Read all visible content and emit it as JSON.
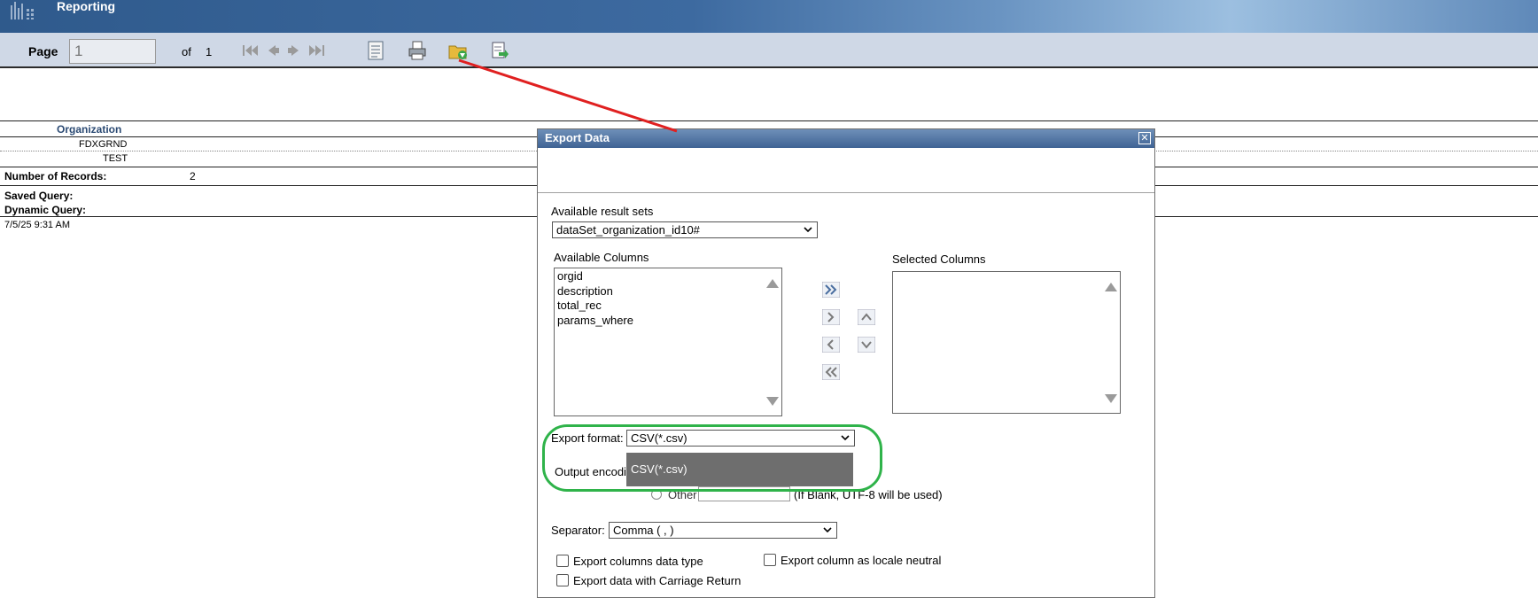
{
  "banner": {
    "title": "Reporting"
  },
  "toolbar": {
    "page_label": "Page",
    "page_value": "1",
    "of_label": "of",
    "total_pages": "1"
  },
  "report": {
    "column_header": "Organization",
    "rows": [
      "FDXGRND",
      "TEST"
    ],
    "records_label": "Number of Records:",
    "records_value": "2",
    "saved_query_label": "Saved Query:",
    "dynamic_query_label": "Dynamic Query:",
    "timestamp": "7/5/25 9:31 AM"
  },
  "dialog": {
    "title": "Export Data",
    "close_glyph": "✕",
    "result_sets_label": "Available result sets",
    "result_set_value": "dataSet_organization_id10#",
    "available_columns_label": "Available Columns",
    "available_columns": [
      "orgid",
      "description",
      "total_rec",
      "params_where"
    ],
    "selected_columns_label": "Selected Columns",
    "export_format_label": "Export format:",
    "export_format_value": "CSV(*.csv)",
    "output_encoding_label": "Output encodi",
    "encoding_dropdown_option": "CSV(*.csv)",
    "other_label": "Other",
    "other_hint": "(If Blank, UTF-8 will be used)",
    "separator_label": "Separator:",
    "separator_value": "Comma ( , )",
    "check_column_types": "Export columns data type",
    "check_locale_neutral": "Export column as locale neutral",
    "check_carriage_return": "Export data with Carriage Return"
  },
  "annotations": {
    "arrow_color": "#e02020",
    "ring_color": "#2fb34a"
  },
  "icons": {
    "nav": [
      "first-page-icon",
      "prev-page-icon",
      "next-page-icon",
      "last-page-icon"
    ],
    "tools": [
      "toc-icon",
      "print-icon",
      "export-data-icon",
      "export-report-icon"
    ]
  }
}
